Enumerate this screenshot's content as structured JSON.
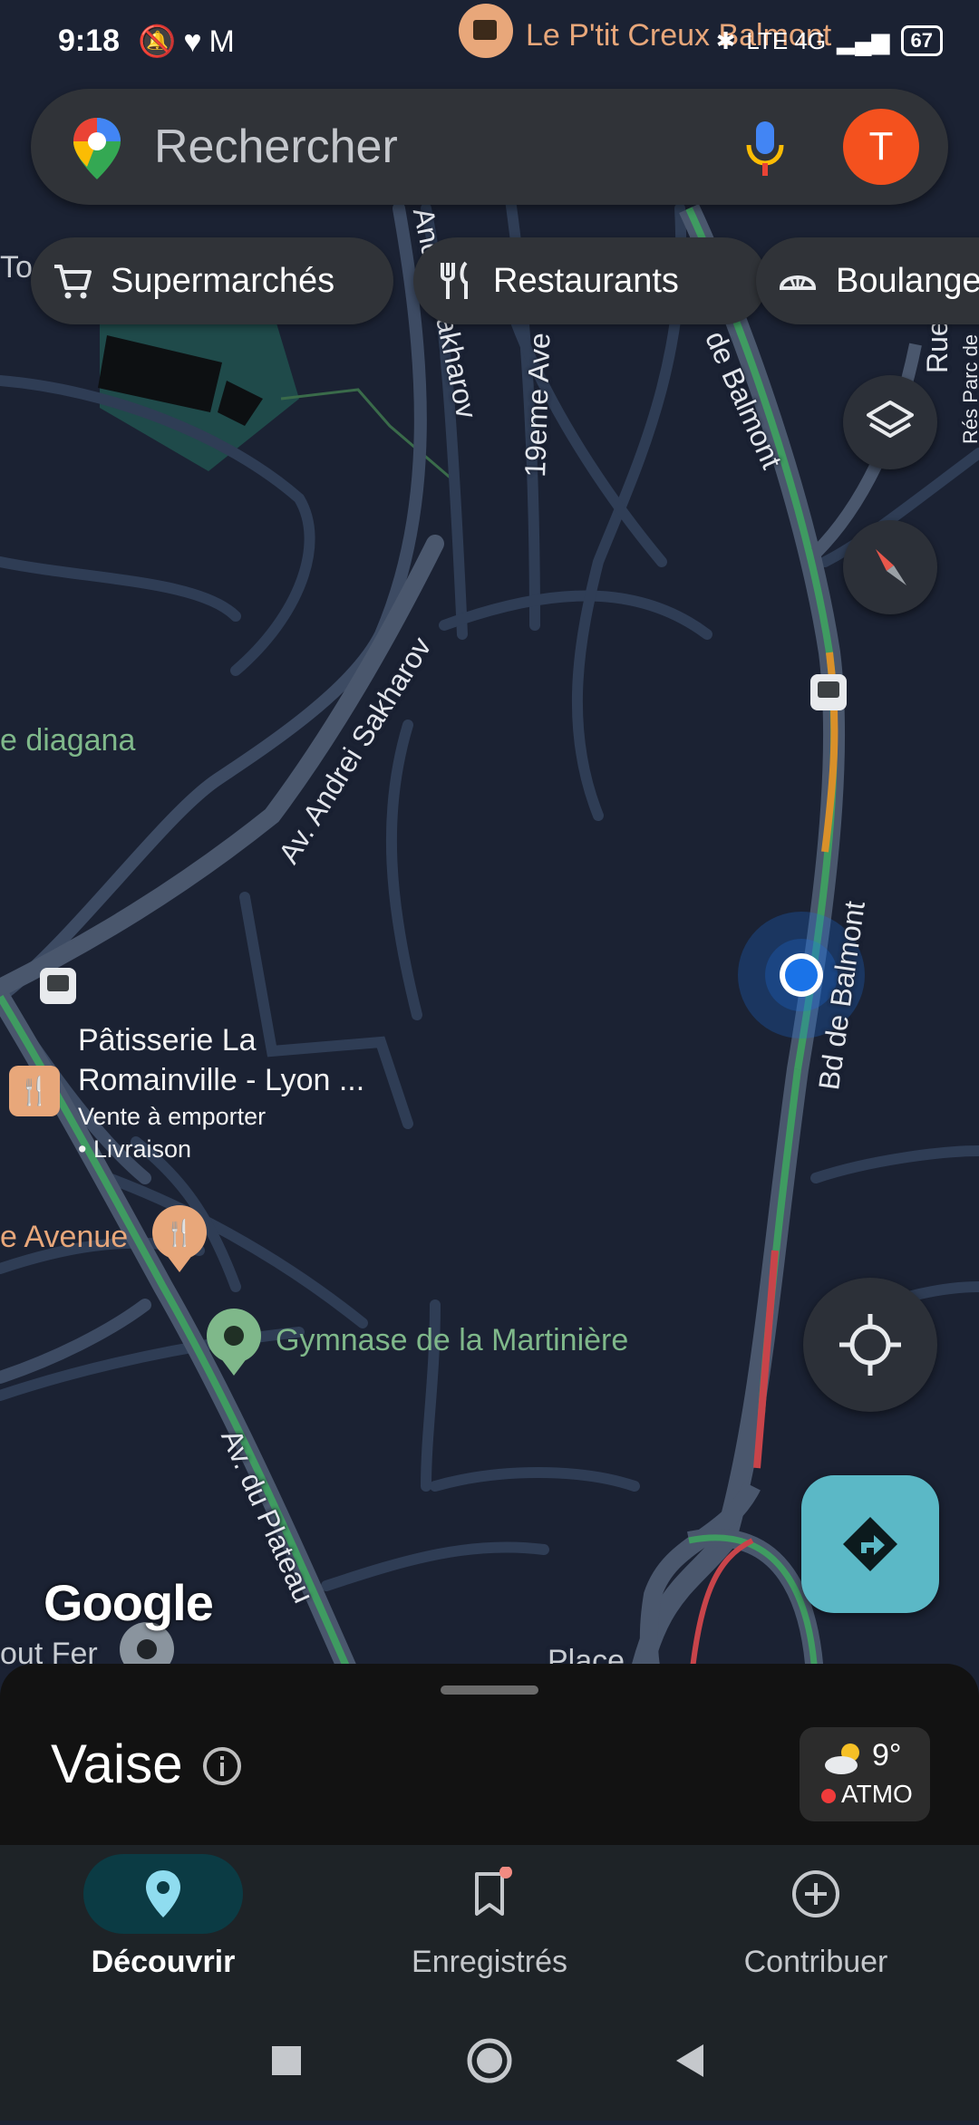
{
  "status_bar": {
    "time": "9:18",
    "notification_icons": [
      "muted-bell-icon",
      "heart-icon",
      "gmail-icon"
    ],
    "network_labels": "LTE 4G",
    "battery": "67"
  },
  "search": {
    "placeholder": "Rechercher",
    "avatar_letter": "T"
  },
  "chips": [
    {
      "label": "Supermarchés",
      "icon": "cart-icon"
    },
    {
      "label": "Restaurants",
      "icon": "fork-knife-icon"
    },
    {
      "label": "Boulange",
      "icon": "bread-icon"
    }
  ],
  "map": {
    "top_poi": "Le P'tit Creux Balmont",
    "left_edge_label_1": "To",
    "roads": {
      "andrei_sakharov_top": "Andrei Sakharov",
      "nineteenth_ave": "19eme Ave",
      "balmont_top": "de Balmont",
      "rue_right": "Rue",
      "res_parc": "Rés Parc de",
      "andrei_sakharov_mid": "Av. Andrei Sakharov",
      "balmont_mid": "Bd de Balmont",
      "plateau": "Av. du Plateau"
    },
    "diagana": "e diagana",
    "patisserie": {
      "name_line1": "Pâtisserie La",
      "name_line2": "Romainville - Lyon ...",
      "detail_line1": "Vente à emporter",
      "detail_line2": "• Livraison"
    },
    "avenue_label": "e Avenue",
    "gymnase": "Gymnase de la Martinière",
    "bottom_left_label": "out Fer",
    "bottom_center_label": "Place",
    "google_logo": "Google"
  },
  "sheet": {
    "place_name": "Vaise",
    "weather_temp": "9°",
    "weather_quality": "ATMO"
  },
  "bottom_nav": [
    {
      "label": "Découvrir",
      "icon": "pin-icon",
      "active": true
    },
    {
      "label": "Enregistrés",
      "icon": "bookmark-icon",
      "active": false
    },
    {
      "label": "Contribuer",
      "icon": "plus-circle-icon",
      "active": false
    }
  ],
  "colors": {
    "map_background": "#1b2233",
    "traffic_green": "#3f9b61",
    "traffic_orange": "#d9902a",
    "traffic_red": "#c8444a",
    "avatar": "#f4511e",
    "directions_fab": "#5bb8c6",
    "location_dot": "#1a73e8"
  }
}
